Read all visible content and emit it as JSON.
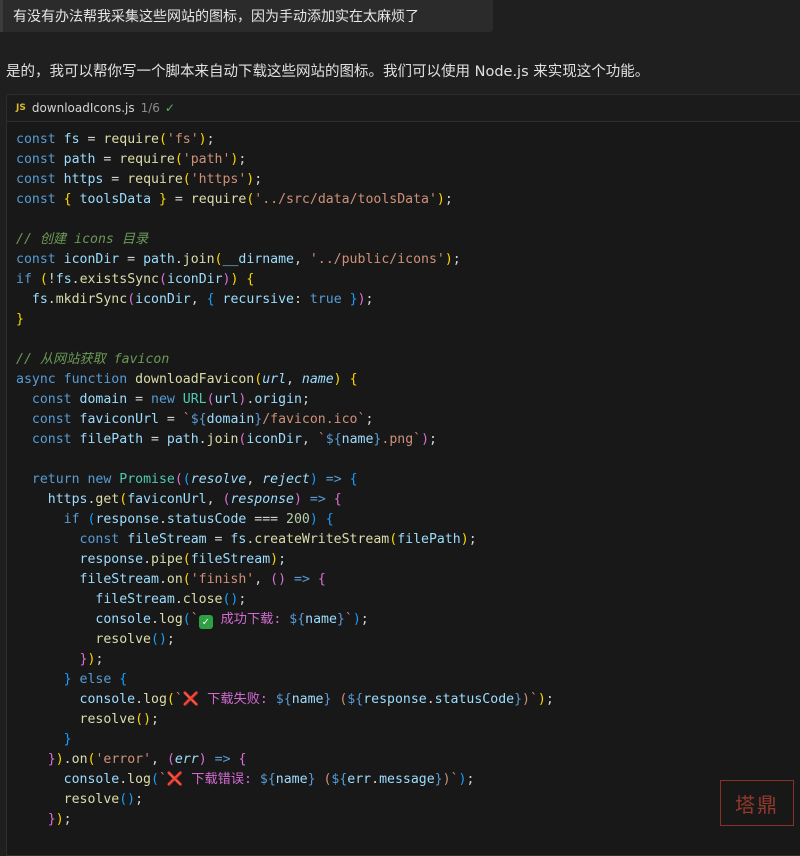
{
  "user_message": "有没有办法帮我采集这些网站的图标，因为手动添加实在太麻烦了",
  "assistant_message": "是的，我可以帮你写一个脚本来自动下载这些网站的图标。我们可以使用 Node.js 来实现这个功能。",
  "code_block": {
    "lang_badge": "JS",
    "filename": "downloadIcons.js",
    "version_label": "1/6",
    "check_icon": "check-icon"
  },
  "code_lines": [
    [
      [
        "kw",
        "const"
      ],
      [
        "pt",
        " "
      ],
      [
        "id",
        "fs"
      ],
      [
        "pt",
        " = "
      ],
      [
        "fn",
        "require"
      ],
      [
        "b1",
        "("
      ],
      [
        "str",
        "'fs'"
      ],
      [
        "b1",
        ")"
      ],
      [
        "pt",
        ";"
      ]
    ],
    [
      [
        "kw",
        "const"
      ],
      [
        "pt",
        " "
      ],
      [
        "id",
        "path"
      ],
      [
        "pt",
        " = "
      ],
      [
        "fn",
        "require"
      ],
      [
        "b1",
        "("
      ],
      [
        "str",
        "'path'"
      ],
      [
        "b1",
        ")"
      ],
      [
        "pt",
        ";"
      ]
    ],
    [
      [
        "kw",
        "const"
      ],
      [
        "pt",
        " "
      ],
      [
        "id",
        "https"
      ],
      [
        "pt",
        " = "
      ],
      [
        "fn",
        "require"
      ],
      [
        "b1",
        "("
      ],
      [
        "str",
        "'https'"
      ],
      [
        "b1",
        ")"
      ],
      [
        "pt",
        ";"
      ]
    ],
    [
      [
        "kw",
        "const"
      ],
      [
        "pt",
        " "
      ],
      [
        "b1",
        "{"
      ],
      [
        "pt",
        " "
      ],
      [
        "id",
        "toolsData"
      ],
      [
        "pt",
        " "
      ],
      [
        "b1",
        "}"
      ],
      [
        "pt",
        " = "
      ],
      [
        "fn",
        "require"
      ],
      [
        "b1",
        "("
      ],
      [
        "str",
        "'../src/data/toolsData'"
      ],
      [
        "b1",
        ")"
      ],
      [
        "pt",
        ";"
      ]
    ],
    [],
    [
      [
        "cm",
        "// 创建 icons 目录"
      ]
    ],
    [
      [
        "kw",
        "const"
      ],
      [
        "pt",
        " "
      ],
      [
        "id",
        "iconDir"
      ],
      [
        "pt",
        " = "
      ],
      [
        "id",
        "path"
      ],
      [
        "pt",
        "."
      ],
      [
        "fn",
        "join"
      ],
      [
        "b1",
        "("
      ],
      [
        "id",
        "__dirname"
      ],
      [
        "pt",
        ", "
      ],
      [
        "str",
        "'../public/icons'"
      ],
      [
        "b1",
        ")"
      ],
      [
        "pt",
        ";"
      ]
    ],
    [
      [
        "kw",
        "if"
      ],
      [
        "pt",
        " "
      ],
      [
        "b1",
        "("
      ],
      [
        "pt",
        "!"
      ],
      [
        "id",
        "fs"
      ],
      [
        "pt",
        "."
      ],
      [
        "fn",
        "existsSync"
      ],
      [
        "b2",
        "("
      ],
      [
        "id",
        "iconDir"
      ],
      [
        "b2",
        ")"
      ],
      [
        "b1",
        ")"
      ],
      [
        "pt",
        " "
      ],
      [
        "b1",
        "{"
      ]
    ],
    [
      [
        "pt",
        "  "
      ],
      [
        "id",
        "fs"
      ],
      [
        "pt",
        "."
      ],
      [
        "fn",
        "mkdirSync"
      ],
      [
        "b2",
        "("
      ],
      [
        "id",
        "iconDir"
      ],
      [
        "pt",
        ", "
      ],
      [
        "b3",
        "{"
      ],
      [
        "pt",
        " "
      ],
      [
        "id",
        "recursive"
      ],
      [
        "pt",
        ": "
      ],
      [
        "kw",
        "true"
      ],
      [
        "pt",
        " "
      ],
      [
        "b3",
        "}"
      ],
      [
        "b2",
        ")"
      ],
      [
        "pt",
        ";"
      ]
    ],
    [
      [
        "b1",
        "}"
      ]
    ],
    [],
    [
      [
        "cm",
        "// 从网站获取 favicon"
      ]
    ],
    [
      [
        "kw",
        "async"
      ],
      [
        "pt",
        " "
      ],
      [
        "kw",
        "function"
      ],
      [
        "pt",
        " "
      ],
      [
        "fn",
        "downloadFavicon"
      ],
      [
        "b1",
        "("
      ],
      [
        "pm",
        "url"
      ],
      [
        "pt",
        ", "
      ],
      [
        "pm",
        "name"
      ],
      [
        "b1",
        ")"
      ],
      [
        "pt",
        " "
      ],
      [
        "b1",
        "{"
      ]
    ],
    [
      [
        "pt",
        "  "
      ],
      [
        "kw",
        "const"
      ],
      [
        "pt",
        " "
      ],
      [
        "id",
        "domain"
      ],
      [
        "pt",
        " = "
      ],
      [
        "kw",
        "new"
      ],
      [
        "pt",
        " "
      ],
      [
        "cn",
        "URL"
      ],
      [
        "b2",
        "("
      ],
      [
        "id",
        "url"
      ],
      [
        "b2",
        ")"
      ],
      [
        "pt",
        "."
      ],
      [
        "id",
        "origin"
      ],
      [
        "pt",
        ";"
      ]
    ],
    [
      [
        "pt",
        "  "
      ],
      [
        "kw",
        "const"
      ],
      [
        "pt",
        " "
      ],
      [
        "id",
        "faviconUrl"
      ],
      [
        "pt",
        " = "
      ],
      [
        "str",
        "`"
      ],
      [
        "tpl",
        "${"
      ],
      [
        "id",
        "domain"
      ],
      [
        "tpl",
        "}"
      ],
      [
        "str",
        "/favicon.ico`"
      ],
      [
        "pt",
        ";"
      ]
    ],
    [
      [
        "pt",
        "  "
      ],
      [
        "kw",
        "const"
      ],
      [
        "pt",
        " "
      ],
      [
        "id",
        "filePath"
      ],
      [
        "pt",
        " = "
      ],
      [
        "id",
        "path"
      ],
      [
        "pt",
        "."
      ],
      [
        "fn",
        "join"
      ],
      [
        "b2",
        "("
      ],
      [
        "id",
        "iconDir"
      ],
      [
        "pt",
        ", "
      ],
      [
        "str",
        "`"
      ],
      [
        "tpl",
        "${"
      ],
      [
        "id",
        "name"
      ],
      [
        "tpl",
        "}"
      ],
      [
        "str",
        ".png`"
      ],
      [
        "b2",
        ")"
      ],
      [
        "pt",
        ";"
      ]
    ],
    [],
    [
      [
        "pt",
        "  "
      ],
      [
        "kw",
        "return"
      ],
      [
        "pt",
        " "
      ],
      [
        "kw",
        "new"
      ],
      [
        "pt",
        " "
      ],
      [
        "cn",
        "Promise"
      ],
      [
        "b2",
        "("
      ],
      [
        "b3",
        "("
      ],
      [
        "pm",
        "resolve"
      ],
      [
        "pt",
        ", "
      ],
      [
        "pm",
        "reject"
      ],
      [
        "b3",
        ")"
      ],
      [
        "pt",
        " "
      ],
      [
        "kw",
        "=>"
      ],
      [
        "pt",
        " "
      ],
      [
        "b3",
        "{"
      ]
    ],
    [
      [
        "pt",
        "    "
      ],
      [
        "id",
        "https"
      ],
      [
        "pt",
        "."
      ],
      [
        "fn",
        "get"
      ],
      [
        "b1",
        "("
      ],
      [
        "id",
        "faviconUrl"
      ],
      [
        "pt",
        ", "
      ],
      [
        "b2",
        "("
      ],
      [
        "pm",
        "response"
      ],
      [
        "b2",
        ")"
      ],
      [
        "pt",
        " "
      ],
      [
        "kw",
        "=>"
      ],
      [
        "pt",
        " "
      ],
      [
        "b2",
        "{"
      ]
    ],
    [
      [
        "pt",
        "      "
      ],
      [
        "kw",
        "if"
      ],
      [
        "pt",
        " "
      ],
      [
        "b3",
        "("
      ],
      [
        "id",
        "response"
      ],
      [
        "pt",
        "."
      ],
      [
        "id",
        "statusCode"
      ],
      [
        "pt",
        " === "
      ],
      [
        "num",
        "200"
      ],
      [
        "b3",
        ")"
      ],
      [
        "pt",
        " "
      ],
      [
        "b3",
        "{"
      ]
    ],
    [
      [
        "pt",
        "        "
      ],
      [
        "kw",
        "const"
      ],
      [
        "pt",
        " "
      ],
      [
        "id",
        "fileStream"
      ],
      [
        "pt",
        " = "
      ],
      [
        "id",
        "fs"
      ],
      [
        "pt",
        "."
      ],
      [
        "fn",
        "createWriteStream"
      ],
      [
        "b1",
        "("
      ],
      [
        "id",
        "filePath"
      ],
      [
        "b1",
        ")"
      ],
      [
        "pt",
        ";"
      ]
    ],
    [
      [
        "pt",
        "        "
      ],
      [
        "id",
        "response"
      ],
      [
        "pt",
        "."
      ],
      [
        "fn",
        "pipe"
      ],
      [
        "b1",
        "("
      ],
      [
        "id",
        "fileStream"
      ],
      [
        "b1",
        ")"
      ],
      [
        "pt",
        ";"
      ]
    ],
    [
      [
        "pt",
        "        "
      ],
      [
        "id",
        "fileStream"
      ],
      [
        "pt",
        "."
      ],
      [
        "fn",
        "on"
      ],
      [
        "b1",
        "("
      ],
      [
        "str",
        "'finish'"
      ],
      [
        "pt",
        ", "
      ],
      [
        "b2",
        "("
      ],
      [
        "b2",
        ")"
      ],
      [
        "pt",
        " "
      ],
      [
        "kw",
        "=>"
      ],
      [
        "pt",
        " "
      ],
      [
        "b2",
        "{"
      ]
    ],
    [
      [
        "pt",
        "          "
      ],
      [
        "id",
        "fileStream"
      ],
      [
        "pt",
        "."
      ],
      [
        "fn",
        "close"
      ],
      [
        "b3",
        "("
      ],
      [
        "b3",
        ")"
      ],
      [
        "pt",
        ";"
      ]
    ],
    [
      [
        "pt",
        "          "
      ],
      [
        "id",
        "console"
      ],
      [
        "pt",
        "."
      ],
      [
        "fn",
        "log"
      ],
      [
        "b3",
        "("
      ],
      [
        "str",
        "`"
      ],
      [
        "ok",
        ""
      ],
      [
        "zh",
        " 成功下载: "
      ],
      [
        "tpl",
        "${"
      ],
      [
        "id",
        "name"
      ],
      [
        "tpl",
        "}"
      ],
      [
        "str",
        "`"
      ],
      [
        "b3",
        ")"
      ],
      [
        "pt",
        ";"
      ]
    ],
    [
      [
        "pt",
        "          "
      ],
      [
        "fn",
        "resolve"
      ],
      [
        "b3",
        "("
      ],
      [
        "b3",
        ")"
      ],
      [
        "pt",
        ";"
      ]
    ],
    [
      [
        "pt",
        "        "
      ],
      [
        "b2",
        "}"
      ],
      [
        "b1",
        ")"
      ],
      [
        "pt",
        ";"
      ]
    ],
    [
      [
        "pt",
        "      "
      ],
      [
        "b3",
        "}"
      ],
      [
        "pt",
        " "
      ],
      [
        "kw",
        "else"
      ],
      [
        "pt",
        " "
      ],
      [
        "b3",
        "{"
      ]
    ],
    [
      [
        "pt",
        "        "
      ],
      [
        "id",
        "console"
      ],
      [
        "pt",
        "."
      ],
      [
        "fn",
        "log"
      ],
      [
        "b1",
        "("
      ],
      [
        "str",
        "`"
      ],
      [
        "x",
        "❌"
      ],
      [
        "zh",
        " 下载失败: "
      ],
      [
        "tpl",
        "${"
      ],
      [
        "id",
        "name"
      ],
      [
        "tpl",
        "}"
      ],
      [
        "str",
        " ("
      ],
      [
        "tpl",
        "${"
      ],
      [
        "id",
        "response"
      ],
      [
        "pt",
        "."
      ],
      [
        "id",
        "statusCode"
      ],
      [
        "tpl",
        "}"
      ],
      [
        "str",
        ")`"
      ],
      [
        "b1",
        ")"
      ],
      [
        "pt",
        ";"
      ]
    ],
    [
      [
        "pt",
        "        "
      ],
      [
        "fn",
        "resolve"
      ],
      [
        "b1",
        "("
      ],
      [
        "b1",
        ")"
      ],
      [
        "pt",
        ";"
      ]
    ],
    [
      [
        "pt",
        "      "
      ],
      [
        "b3",
        "}"
      ]
    ],
    [
      [
        "pt",
        "    "
      ],
      [
        "b2",
        "}"
      ],
      [
        "b1",
        ")"
      ],
      [
        "pt",
        "."
      ],
      [
        "fn",
        "on"
      ],
      [
        "b1",
        "("
      ],
      [
        "str",
        "'error'"
      ],
      [
        "pt",
        ", "
      ],
      [
        "b2",
        "("
      ],
      [
        "pm",
        "err"
      ],
      [
        "b2",
        ")"
      ],
      [
        "pt",
        " "
      ],
      [
        "kw",
        "=>"
      ],
      [
        "pt",
        " "
      ],
      [
        "b2",
        "{"
      ]
    ],
    [
      [
        "pt",
        "      "
      ],
      [
        "id",
        "console"
      ],
      [
        "pt",
        "."
      ],
      [
        "fn",
        "log"
      ],
      [
        "b3",
        "("
      ],
      [
        "str",
        "`"
      ],
      [
        "x",
        "❌"
      ],
      [
        "zh",
        " 下载错误: "
      ],
      [
        "tpl",
        "${"
      ],
      [
        "id",
        "name"
      ],
      [
        "tpl",
        "}"
      ],
      [
        "str",
        " ("
      ],
      [
        "tpl",
        "${"
      ],
      [
        "id",
        "err"
      ],
      [
        "pt",
        "."
      ],
      [
        "id",
        "message"
      ],
      [
        "tpl",
        "}"
      ],
      [
        "str",
        ")`"
      ],
      [
        "b3",
        ")"
      ],
      [
        "pt",
        ";"
      ]
    ],
    [
      [
        "pt",
        "      "
      ],
      [
        "fn",
        "resolve"
      ],
      [
        "b3",
        "("
      ],
      [
        "b3",
        ")"
      ],
      [
        "pt",
        ";"
      ]
    ],
    [
      [
        "pt",
        "    "
      ],
      [
        "b2",
        "}"
      ],
      [
        "b1",
        ")"
      ],
      [
        "pt",
        ";"
      ]
    ]
  ],
  "watermark_text": "塔鼎"
}
